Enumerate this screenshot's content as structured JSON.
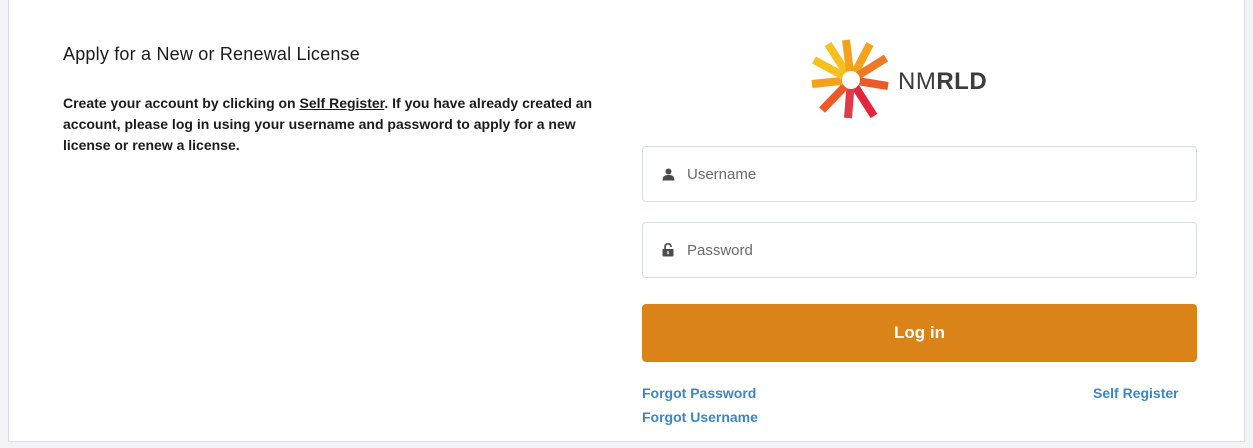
{
  "left": {
    "heading": "Apply for a New or Renewal License",
    "desc_prefix": "Create your account by clicking on ",
    "desc_link": "Self Register",
    "desc_suffix": ". If you have already created an account, please log in using your username and password to apply for a new license or renew a license."
  },
  "logo": {
    "text_light": "NM",
    "text_bold": "RLD",
    "icon": "starburst-logo-icon",
    "colors": [
      "#f4a21c",
      "#ec5a29",
      "#e2253a",
      "#f6c11f"
    ]
  },
  "form": {
    "username_placeholder": "Username",
    "password_placeholder": "Password",
    "user_icon": "person-icon",
    "lock_icon": "lock-icon",
    "login_label": "Log in",
    "login_color": "#d98318"
  },
  "links": {
    "forgot_password": "Forgot Password",
    "forgot_username": "Forgot Username",
    "self_register": "Self Register",
    "link_color": "#3a87c6"
  }
}
